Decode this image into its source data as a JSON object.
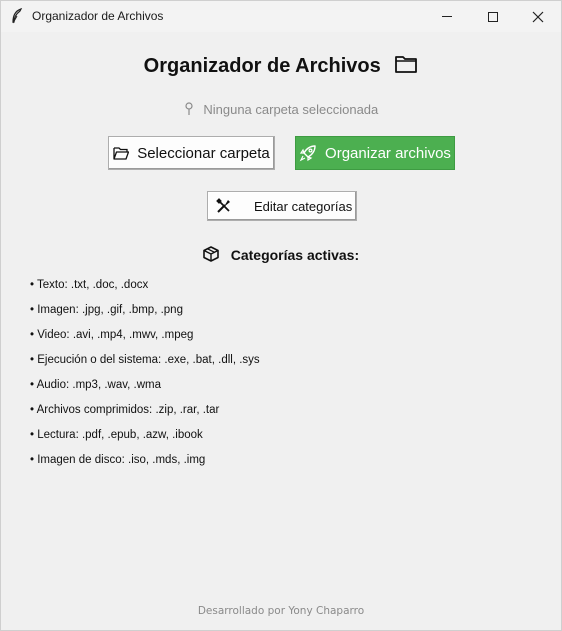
{
  "window": {
    "title": "Organizador de Archivos"
  },
  "header": {
    "title": "Organizador de Archivos",
    "icon": "folder-icon"
  },
  "status": {
    "text": "Ninguna carpeta seleccionada",
    "icon": "pin-icon"
  },
  "actions": {
    "select_label": "Seleccionar carpeta",
    "organize_label": "Organizar archivos",
    "edit_label": "Editar categorías",
    "organize_color": "#4caf50"
  },
  "categories": {
    "title": "Categorías activas:",
    "items": [
      "• Texto: .txt, .doc, .docx",
      "• Imagen: .jpg, .gif, .bmp, .png",
      "• Video: .avi, .mp4, .mwv, .mpeg",
      "• Ejecución o del sistema: .exe, .bat, .dll, .sys",
      "• Audio: .mp3, .wav, .wma",
      "• Archivos comprimidos: .zip, .rar, .tar",
      "• Lectura: .pdf, .epub, .azw, .ibook",
      "• Imagen de disco: .iso, .mds, .img"
    ]
  },
  "footer": {
    "text": "Desarrollado por Yony Chaparro"
  }
}
